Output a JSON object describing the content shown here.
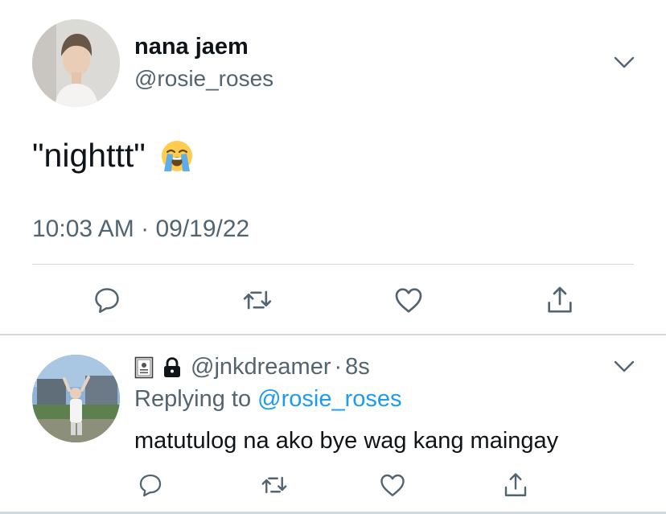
{
  "main_tweet": {
    "display_name": "nana jaem",
    "handle": "@rosie_roses",
    "text": "\"nighttt\"",
    "emoji": "loudly-crying-face-emoji",
    "time": "10:03 AM",
    "separator": "·",
    "date": "09/19/22"
  },
  "reply_tweet": {
    "badges": [
      "contact-card-emoji",
      "lock-icon"
    ],
    "handle": "@jnkdreamer",
    "separator": "·",
    "age": "8s",
    "replying_prefix": "Replying to",
    "replying_handle": "@rosie_roses",
    "text": "matutulog na ako bye wag kang maingay"
  },
  "actions": [
    "reply-icon",
    "retweet-icon",
    "like-icon",
    "share-icon"
  ],
  "colors": {
    "text_primary": "#0f1419",
    "text_secondary": "#536471",
    "link": "#1d9bf0",
    "divider": "#cfd9de"
  }
}
